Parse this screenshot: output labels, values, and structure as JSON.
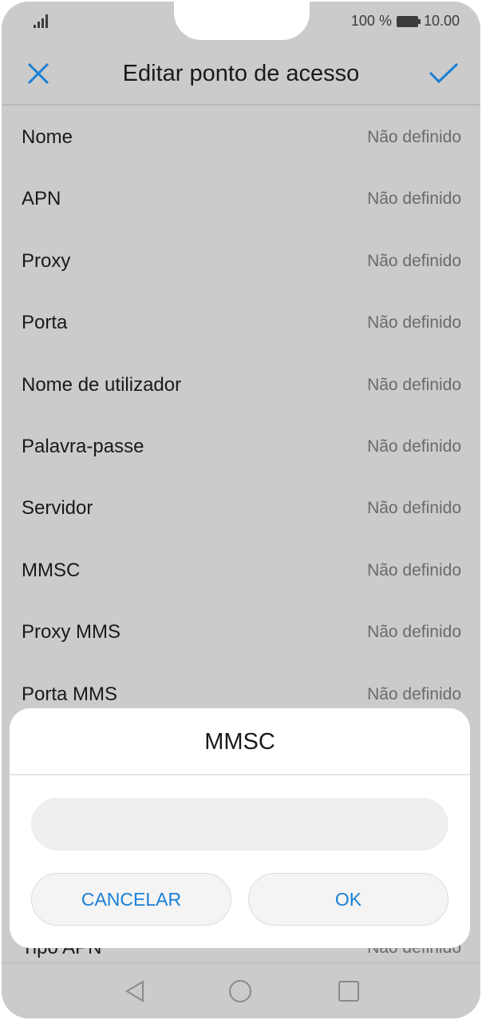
{
  "status_bar": {
    "battery_text": "100 %",
    "time": "10.00"
  },
  "header": {
    "title": "Editar ponto de acesso"
  },
  "list": [
    {
      "label": "Nome",
      "value": "Não definido"
    },
    {
      "label": "APN",
      "value": "Não definido"
    },
    {
      "label": "Proxy",
      "value": "Não definido"
    },
    {
      "label": "Porta",
      "value": "Não definido"
    },
    {
      "label": "Nome de utilizador",
      "value": "Não definido"
    },
    {
      "label": "Palavra-passe",
      "value": "Não definido"
    },
    {
      "label": "Servidor",
      "value": "Não definido"
    },
    {
      "label": "MMSC",
      "value": "Não definido"
    },
    {
      "label": "Proxy MMS",
      "value": "Não definido"
    },
    {
      "label": "Porta MMS",
      "value": "Não definido"
    }
  ],
  "hidden_row": {
    "label": "Tipo APN",
    "value": "Não definido"
  },
  "dialog": {
    "title": "MMSC",
    "input_value": "",
    "cancel_label": "CANCELAR",
    "ok_label": "OK"
  },
  "colors": {
    "accent": "#1a7fd6",
    "overlay_bg": "#cbcbcb"
  },
  "icons": {
    "close": "close-icon",
    "check": "check-icon",
    "back": "back-triangle-icon",
    "home": "home-circle-icon",
    "recents": "recents-square-icon"
  }
}
